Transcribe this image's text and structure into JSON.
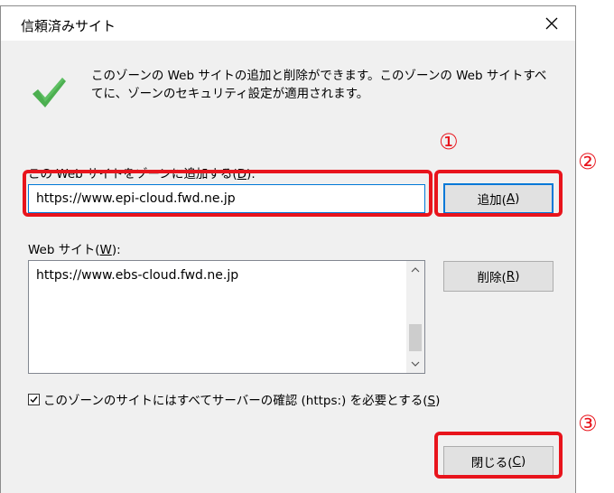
{
  "dialog": {
    "title": "信頼済みサイト",
    "info_text": "このゾーンの Web サイトの追加と削除ができます。このゾーンの Web サイトすべてに、ゾーンのセキュリティ設定が適用されます。"
  },
  "add_section": {
    "label": "この Web サイトをゾーンに追加する(D):",
    "input_value": "https://www.epi-cloud.fwd.ne.jp",
    "add_button": "追加(A)"
  },
  "sites_section": {
    "label": "Web サイト(W):",
    "items": [
      "https://www.ebs-cloud.fwd.ne.jp"
    ],
    "remove_button": "削除(R)"
  },
  "require_https": {
    "checked": true,
    "label": "このゾーンのサイトにはすべてサーバーの確認 (https:) を必要とする(S)"
  },
  "close_button": "閉じる(C)",
  "annotations": {
    "step1": "①",
    "step2": "②",
    "step3": "③",
    "color": "#e8141c"
  }
}
